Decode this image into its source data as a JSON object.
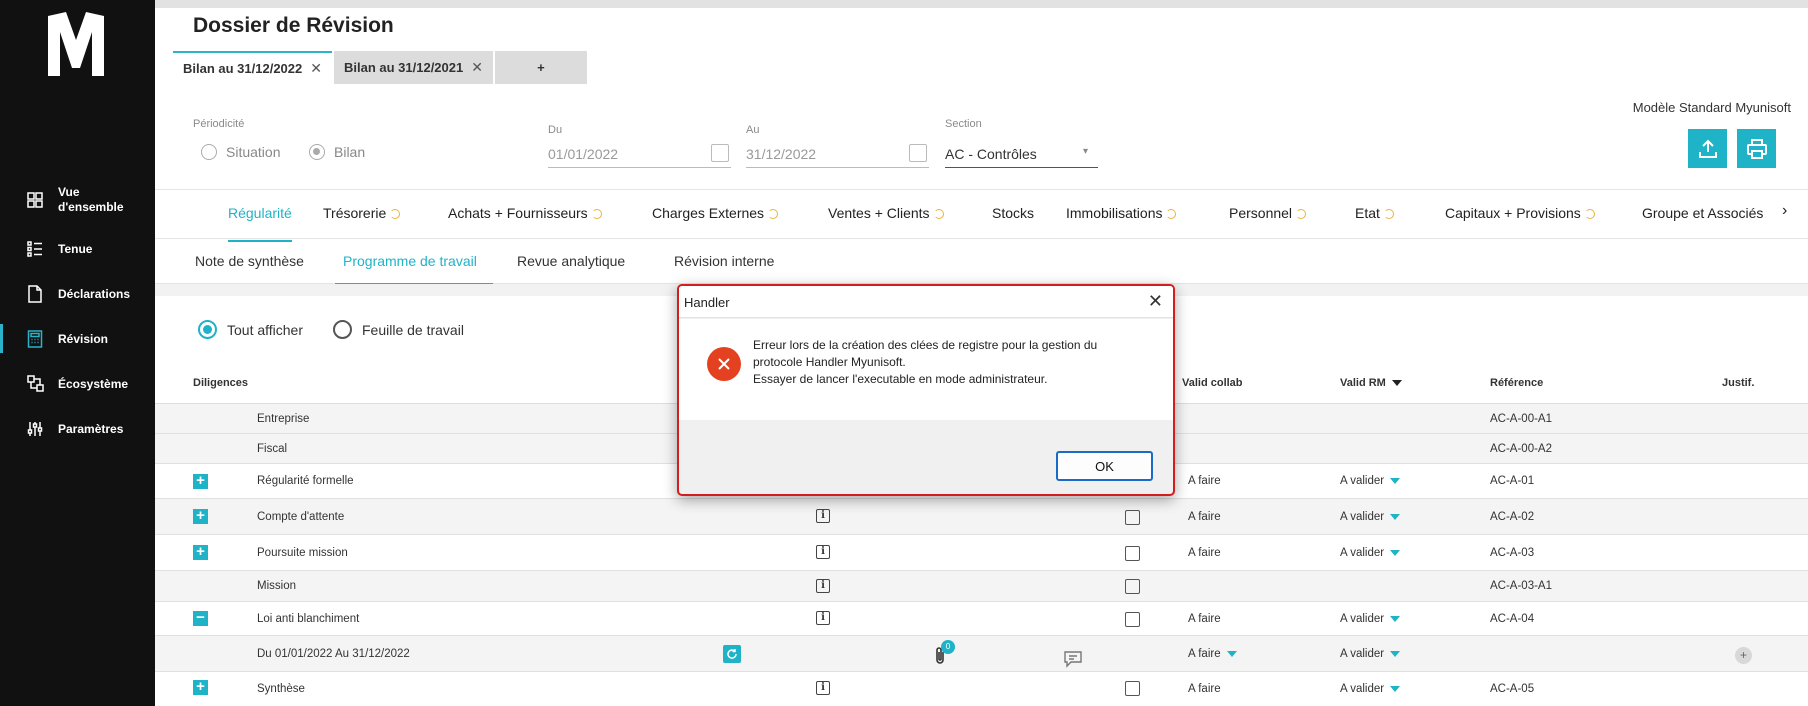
{
  "sidebar": {
    "items": [
      {
        "label": "Vue d'ensemble",
        "icon": "grid-icon"
      },
      {
        "label": "Tenue",
        "icon": "list-icon"
      },
      {
        "label": "Déclarations",
        "icon": "document-icon"
      },
      {
        "label": "Révision",
        "icon": "calculator-icon"
      },
      {
        "label": "Écosystème",
        "icon": "ecosystem-icon"
      },
      {
        "label": "Paramètres",
        "icon": "sliders-icon"
      }
    ],
    "item0_line1": "Vue",
    "item0_line2": "d'ensemble"
  },
  "header": {
    "title": "Dossier de Révision",
    "file_tabs": [
      {
        "label": "Bilan au 31/12/2022"
      },
      {
        "label": "Bilan au 31/12/2021"
      }
    ],
    "add_tab_label": "+"
  },
  "filters": {
    "periodicite_label": "Périodicité",
    "option_situation": "Situation",
    "option_bilan": "Bilan",
    "du_label": "Du",
    "du_value": "01/01/2022",
    "au_label": "Au",
    "au_value": "31/12/2022",
    "section_label": "Section",
    "section_value": "AC - Contrôles",
    "modele": "Modèle Standard Myunisoft"
  },
  "categories": [
    "Régularité",
    "Trésorerie",
    "Achats + Fournisseurs",
    "Charges Externes",
    "Ventes + Clients",
    "Stocks",
    "Immobilisations",
    "Personnel",
    "Etat",
    "Capitaux + Provisions",
    "Groupe et Associés"
  ],
  "subtabs": [
    "Note de synthèse",
    "Programme de travail",
    "Revue analytique",
    "Révision interne"
  ],
  "view": {
    "all": "Tout afficher",
    "worksheet": "Feuille de travail"
  },
  "table": {
    "headers": {
      "diligences": "Diligences",
      "valid_collab": "Valid collab",
      "valid_rm": "Valid RM",
      "reference": "Référence",
      "justif": "Justif."
    },
    "rows": [
      {
        "label": "Entreprise",
        "ref": "AC-A-00-A1"
      },
      {
        "label": "Fiscal",
        "ref": "AC-A-00-A2"
      },
      {
        "label": "Régularité formelle",
        "collab": "A faire",
        "rm": "A valider",
        "ref": "AC-A-01"
      },
      {
        "label": "Compte d'attente",
        "collab": "A faire",
        "rm": "A valider",
        "ref": "AC-A-02"
      },
      {
        "label": "Poursuite mission",
        "collab": "A faire",
        "rm": "A valider",
        "ref": "AC-A-03"
      },
      {
        "label": "Mission",
        "ref": "AC-A-03-A1"
      },
      {
        "label": "Loi anti blanchiment",
        "collab": "A faire",
        "rm": "A valider",
        "ref": "AC-A-04"
      },
      {
        "label": "Du 01/01/2022 Au 31/12/2022",
        "collab": "A faire",
        "rm": "A valider"
      },
      {
        "label": "Synthèse",
        "collab": "A faire",
        "rm": "A valider",
        "ref": "AC-A-05"
      }
    ],
    "attachment_count": "0"
  },
  "dialog": {
    "title": "Handler",
    "line1": "Erreur lors de la création des clées de registre pour la gestion du",
    "line2": "protocole Handler Myunisoft.",
    "line3": "Essayer de lancer l'executable en mode administrateur.",
    "ok_label": "OK"
  },
  "colors": {
    "accent": "#1fb3c8",
    "error": "#e3411f",
    "dialog_border": "#d21e1e"
  }
}
